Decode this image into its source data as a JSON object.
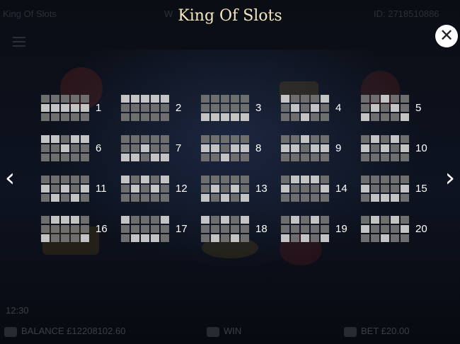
{
  "header": {
    "title": "King Of Slots",
    "bg_left_text": "King Of Slots",
    "bg_mid_text": "W",
    "bg_right_text": "ID: 2718510886"
  },
  "nav": {
    "prev_label": "‹",
    "next_label": "›",
    "close_label": "✕"
  },
  "paylines": [
    {
      "number": "1",
      "pattern": [
        [
          0,
          0,
          0,
          0,
          0
        ],
        [
          1,
          1,
          1,
          1,
          1
        ],
        [
          0,
          0,
          0,
          0,
          0
        ]
      ]
    },
    {
      "number": "2",
      "pattern": [
        [
          1,
          1,
          1,
          1,
          1
        ],
        [
          0,
          0,
          0,
          0,
          0
        ],
        [
          0,
          0,
          0,
          0,
          0
        ]
      ]
    },
    {
      "number": "3",
      "pattern": [
        [
          0,
          0,
          0,
          0,
          0
        ],
        [
          0,
          0,
          0,
          0,
          0
        ],
        [
          1,
          1,
          1,
          1,
          1
        ]
      ]
    },
    {
      "number": "4",
      "pattern": [
        [
          1,
          0,
          0,
          0,
          1
        ],
        [
          0,
          1,
          0,
          1,
          0
        ],
        [
          0,
          0,
          1,
          0,
          0
        ]
      ]
    },
    {
      "number": "5",
      "pattern": [
        [
          0,
          0,
          1,
          0,
          0
        ],
        [
          0,
          1,
          0,
          1,
          0
        ],
        [
          1,
          0,
          0,
          0,
          1
        ]
      ]
    },
    {
      "number": "6",
      "pattern": [
        [
          1,
          1,
          0,
          1,
          1
        ],
        [
          0,
          0,
          1,
          0,
          0
        ],
        [
          0,
          0,
          0,
          0,
          0
        ]
      ]
    },
    {
      "number": "7",
      "pattern": [
        [
          0,
          0,
          0,
          0,
          0
        ],
        [
          0,
          0,
          1,
          0,
          0
        ],
        [
          1,
          1,
          0,
          1,
          1
        ]
      ]
    },
    {
      "number": "8",
      "pattern": [
        [
          0,
          0,
          0,
          0,
          0
        ],
        [
          1,
          1,
          0,
          1,
          1
        ],
        [
          0,
          0,
          1,
          0,
          0
        ]
      ]
    },
    {
      "number": "9",
      "pattern": [
        [
          0,
          0,
          1,
          0,
          0
        ],
        [
          1,
          1,
          0,
          1,
          1
        ],
        [
          0,
          0,
          0,
          0,
          0
        ]
      ]
    },
    {
      "number": "10",
      "pattern": [
        [
          0,
          1,
          0,
          1,
          0
        ],
        [
          1,
          0,
          1,
          0,
          1
        ],
        [
          0,
          0,
          0,
          0,
          0
        ]
      ]
    },
    {
      "number": "11",
      "pattern": [
        [
          0,
          0,
          0,
          0,
          0
        ],
        [
          1,
          0,
          1,
          0,
          1
        ],
        [
          0,
          1,
          0,
          1,
          0
        ]
      ]
    },
    {
      "number": "12",
      "pattern": [
        [
          1,
          0,
          1,
          0,
          1
        ],
        [
          0,
          1,
          0,
          1,
          0
        ],
        [
          0,
          0,
          0,
          0,
          0
        ]
      ]
    },
    {
      "number": "13",
      "pattern": [
        [
          0,
          0,
          0,
          0,
          0
        ],
        [
          0,
          1,
          0,
          1,
          0
        ],
        [
          1,
          0,
          1,
          0,
          1
        ]
      ]
    },
    {
      "number": "14",
      "pattern": [
        [
          0,
          1,
          1,
          1,
          0
        ],
        [
          1,
          0,
          0,
          0,
          1
        ],
        [
          0,
          0,
          0,
          0,
          0
        ]
      ]
    },
    {
      "number": "15",
      "pattern": [
        [
          0,
          0,
          0,
          0,
          0
        ],
        [
          1,
          0,
          0,
          0,
          1
        ],
        [
          0,
          1,
          1,
          1,
          0
        ]
      ]
    },
    {
      "number": "16",
      "pattern": [
        [
          0,
          1,
          1,
          1,
          0
        ],
        [
          0,
          0,
          0,
          0,
          0
        ],
        [
          1,
          0,
          0,
          0,
          1
        ]
      ]
    },
    {
      "number": "17",
      "pattern": [
        [
          1,
          0,
          0,
          0,
          1
        ],
        [
          0,
          0,
          0,
          0,
          0
        ],
        [
          0,
          1,
          1,
          1,
          0
        ]
      ]
    },
    {
      "number": "18",
      "pattern": [
        [
          1,
          0,
          1,
          0,
          1
        ],
        [
          0,
          0,
          0,
          0,
          0
        ],
        [
          0,
          1,
          0,
          1,
          0
        ]
      ]
    },
    {
      "number": "19",
      "pattern": [
        [
          0,
          1,
          0,
          1,
          0
        ],
        [
          0,
          0,
          0,
          0,
          0
        ],
        [
          1,
          0,
          1,
          0,
          1
        ]
      ]
    },
    {
      "number": "20",
      "pattern": [
        [
          0,
          1,
          0,
          1,
          0
        ],
        [
          1,
          0,
          0,
          0,
          1
        ],
        [
          0,
          0,
          1,
          0,
          0
        ]
      ]
    }
  ],
  "footer": {
    "time": "12:30",
    "balance": "BALANCE  £12208102.60",
    "win": "WIN",
    "bet": "BET  £20.00"
  },
  "colors": {
    "cell_active": "#c3c3c3",
    "cell_inactive": "#6e6e6e",
    "title": "#f5e6c0"
  }
}
